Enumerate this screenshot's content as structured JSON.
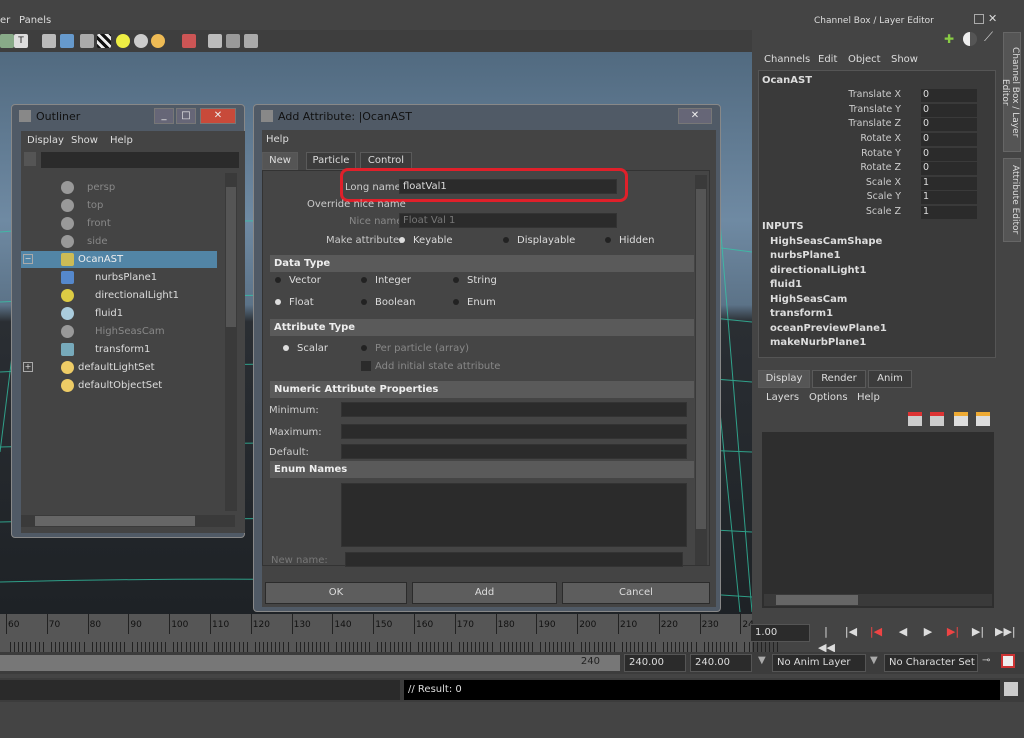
{
  "menubar": {
    "items": [
      "er",
      "Panels"
    ]
  },
  "channel_box": {
    "title": "Channel Box / Layer Editor",
    "menus": [
      "Channels",
      "Edit",
      "Object",
      "Show"
    ],
    "object_name": "OcanAST",
    "attributes": [
      {
        "label": "Translate X",
        "value": "0"
      },
      {
        "label": "Translate Y",
        "value": "0"
      },
      {
        "label": "Translate Z",
        "value": "0"
      },
      {
        "label": "Rotate X",
        "value": "0"
      },
      {
        "label": "Rotate Y",
        "value": "0"
      },
      {
        "label": "Rotate Z",
        "value": "0"
      },
      {
        "label": "Scale X",
        "value": "1"
      },
      {
        "label": "Scale Y",
        "value": "1"
      },
      {
        "label": "Scale Z",
        "value": "1"
      }
    ],
    "inputs_label": "INPUTS",
    "inputs": [
      "HighSeasCamShape",
      "nurbsPlane1",
      "directionalLight1",
      "fluid1",
      "HighSeasCam",
      "transform1",
      "oceanPreviewPlane1",
      "makeNurbPlane1"
    ],
    "side_tabs": [
      "Channel Box / Layer Editor",
      "Attribute Editor"
    ]
  },
  "layer_editor": {
    "tabs": [
      "Display",
      "Render",
      "Anim"
    ],
    "menus": [
      "Layers",
      "Options",
      "Help"
    ]
  },
  "outliner": {
    "title": "Outliner",
    "menus": [
      "Display",
      "Show",
      "Help"
    ],
    "items": [
      {
        "label": "persp",
        "dim": true
      },
      {
        "label": "top",
        "dim": true
      },
      {
        "label": "front",
        "dim": true
      },
      {
        "label": "side",
        "dim": true
      },
      {
        "label": "OcanAST",
        "selected": true
      },
      {
        "label": "nurbsPlane1"
      },
      {
        "label": "directionalLight1"
      },
      {
        "label": "fluid1"
      },
      {
        "label": "HighSeasCam",
        "dim": true
      },
      {
        "label": "transform1"
      },
      {
        "label": "defaultLightSet"
      },
      {
        "label": "defaultObjectSet"
      }
    ]
  },
  "add_attribute": {
    "title": "Add Attribute: |OcanAST",
    "menu": "Help",
    "tabs": [
      "New",
      "Particle",
      "Control"
    ],
    "long_name_label": "Long name:",
    "long_name_value": "floatVal1",
    "override_label": "Override nice name",
    "nice_name_label": "Nice name:",
    "nice_name_value": "Float Val 1",
    "make_attr_label": "Make attribute:",
    "make_attr_options": [
      "Keyable",
      "Displayable",
      "Hidden"
    ],
    "data_type_title": "Data Type",
    "data_types": [
      "Vector",
      "Integer",
      "String",
      "Float",
      "Boolean",
      "Enum"
    ],
    "attr_type_title": "Attribute Type",
    "scalar_label": "Scalar",
    "per_particle_label": "Per particle (array)",
    "initial_state_label": "Add initial state attribute",
    "numeric_title": "Numeric Attribute Properties",
    "minimum_label": "Minimum:",
    "maximum_label": "Maximum:",
    "default_label": "Default:",
    "enum_title": "Enum Names",
    "new_name_label": "New name:",
    "buttons": [
      "OK",
      "Add",
      "Cancel"
    ],
    "highlight_color": "#e0202a"
  },
  "timeline": {
    "ticks": [
      "60",
      "70",
      "80",
      "90",
      "100",
      "110",
      "120",
      "130",
      "140",
      "150",
      "160",
      "170",
      "180",
      "190",
      "200",
      "210",
      "220",
      "230",
      "24"
    ],
    "current_frame": "1.00",
    "range_end": "240",
    "range_field_1": "240.00",
    "range_field_2": "240.00",
    "anim_layer": "No Anim Layer",
    "character_set": "No Character Set"
  },
  "command_line": {
    "result": "// Result: 0"
  }
}
